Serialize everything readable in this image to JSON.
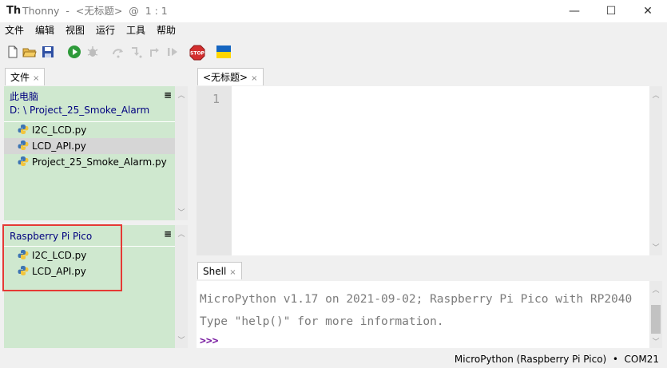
{
  "window": {
    "title": "Thonny  -  <无标题>  @  1 : 1",
    "logo": "Th",
    "minimize": "—",
    "maximize": "☐",
    "close": "✕"
  },
  "menu": [
    "文件",
    "编辑",
    "视图",
    "运行",
    "工具",
    "帮助"
  ],
  "toolbar": {
    "icons": [
      "new-file-icon",
      "open-folder-icon",
      "save-icon",
      "run-icon",
      "debug-icon",
      "step-over-icon",
      "step-into-icon",
      "step-out-icon",
      "resume-icon",
      "stop-icon",
      "ukraine-flag-icon"
    ],
    "stop_label": "STOP"
  },
  "files_tab": {
    "label": "文件",
    "close": "×"
  },
  "local_pane": {
    "title": "此电脑",
    "path": "D: \\ Project_25_Smoke_Alarm",
    "menu": "≡",
    "files": [
      "I2C_LCD.py",
      "LCD_API.py",
      "Project_25_Smoke_Alarm.py"
    ]
  },
  "device_pane": {
    "title": "Raspberry Pi Pico",
    "menu": "≡",
    "files": [
      "I2C_LCD.py",
      "LCD_API.py"
    ]
  },
  "editor_tab": {
    "label": "<无标题>",
    "close": "×"
  },
  "editor": {
    "line_number": "1"
  },
  "shell_tab": {
    "label": "Shell",
    "close": "×"
  },
  "shell": {
    "line1": "MicroPython v1.17 on 2021-09-02; Raspberry Pi Pico with RP2040",
    "line2": "Type \"help()\" for more information.",
    "prompt": ">>>"
  },
  "status": {
    "interpreter": "MicroPython (Raspberry Pi Pico)  •  COM21"
  },
  "colors": {
    "pane_bg": "#cfe8cf",
    "highlight": "#e53935",
    "title_blue": "#00007f",
    "prompt": "#7a1ea1"
  }
}
